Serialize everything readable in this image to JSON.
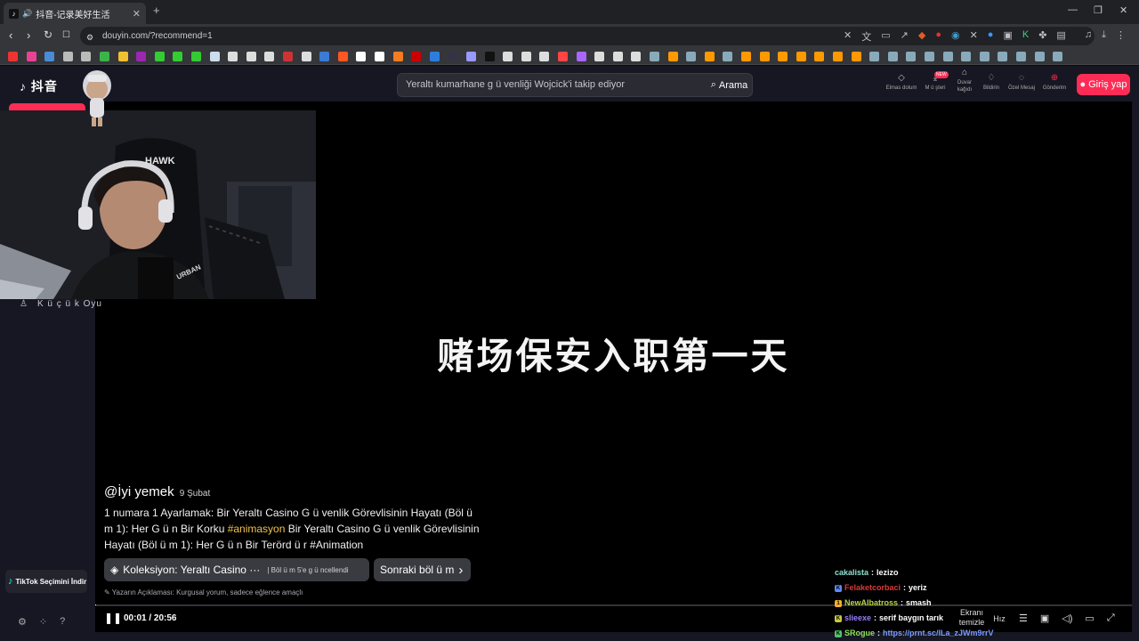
{
  "browser": {
    "tab_title": "抖音-记录美好生活",
    "tab_favicon": "♪",
    "url": "douyin.com/?recommend=1",
    "new_tab": "+",
    "win_controls": [
      "—",
      "❐",
      "✕"
    ]
  },
  "header": {
    "logo": "抖音",
    "search_placeholder": "Yeraltı kumarhane g ü venliği Wojcick'i takip ediyor",
    "search_button": "Arama",
    "new_badge": "NEW",
    "actions": [
      {
        "icon": "diamond-icon",
        "label": "Elmas dolum"
      },
      {
        "icon": "download-icon",
        "label": "M ü şteri"
      },
      {
        "icon": "wallpaper-icon",
        "label": "Duvar kağıdı"
      },
      {
        "icon": "bell-icon",
        "label": "Bildirin"
      },
      {
        "icon": "message-icon",
        "label": "Özel Mesaj"
      },
      {
        "icon": "upload-icon",
        "label": "Gönderim"
      }
    ],
    "login": "Giriş yap"
  },
  "sidebar": {
    "item_label": "K ü ç ü k Oyu",
    "promo": "TikTok Seçimini İndir"
  },
  "video": {
    "subtitle": "赌场保安入职第一天",
    "author": "@İyi yemek",
    "date": "9 Şubat",
    "desc_part1": "1 numara 1 Ayarlamak: Bir Yeraltı Casino G ü venlik Görevlisinin Hayatı (Böl ü m 1): Her G ü n Bir Korku ",
    "hashtag": "#animasyon",
    "desc_part2": " Bir Yeraltı Casino G ü venlik Görevlisinin Hayatı (Böl ü m 1): Her G ü n Bir Terörd ü r #Animation",
    "collection": "Koleksiyon: Yeraltı Casino ···",
    "collection_update": "Böl ü m 5'e g ü ncellendi",
    "next_episode": "Sonraki böl ü m",
    "disclaimer": "Yazarın Açıklaması: Kurgusal yorum, sadece eğlence amaçlı",
    "time_current": "00:01",
    "time_total": "20:56",
    "progress": 0.0008,
    "speed_label": "Hız",
    "clear_label": "Ekranı temizle"
  },
  "chat": [
    {
      "user": "cakalista",
      "color": "#8fe0d0",
      "badge": "",
      "msg": "lezizo"
    },
    {
      "user": "Felaketcorbaci",
      "color": "#d93a3a",
      "badge": "K",
      "badge_color": "#5b8cff",
      "msg": "yeriz"
    },
    {
      "user": "NewAlbatross",
      "color": "#b6d64a",
      "badge": "1",
      "badge_color": "#f0b030",
      "msg": "smash"
    },
    {
      "user": "slieexe",
      "color": "#9a7cff",
      "badge": "K",
      "badge_color": "#c9c93a",
      "msg": "serif baygın tarık"
    },
    {
      "user": "SRogue",
      "color": "#8fe05a",
      "badge": "K",
      "badge_color": "#53c16b",
      "msg": "https://prnt.sc/lLa_zJWm9rrV"
    }
  ]
}
